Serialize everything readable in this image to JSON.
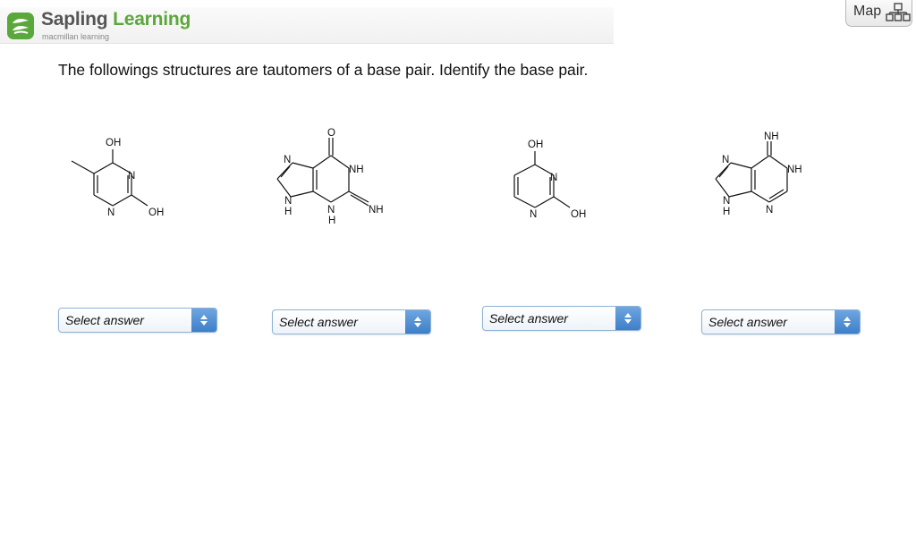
{
  "header": {
    "brand_part1": "Sapling",
    "brand_part2": "Learning",
    "brand_sub": "macmillan learning",
    "logo_icon": "sapling-leaf-icon"
  },
  "map_button": {
    "label": "Map",
    "icon": "sitemap-icon"
  },
  "question": {
    "text": "The followings structures are tautomers of a base pair. Identify the base pair."
  },
  "structures": {
    "s1": {
      "atoms": [
        "OH",
        "N",
        "N",
        "OH"
      ]
    },
    "s2": {
      "atoms": [
        "O",
        "N",
        "NH",
        "N",
        "H",
        "N",
        "H",
        "NH"
      ]
    },
    "s3": {
      "atoms": [
        "OH",
        "N",
        "N",
        "OH"
      ]
    },
    "s4": {
      "atoms": [
        "NH",
        "N",
        "NH",
        "N",
        "H",
        "N"
      ]
    }
  },
  "answers": [
    {
      "placeholder": "Select answer"
    },
    {
      "placeholder": "Select answer"
    },
    {
      "placeholder": "Select answer"
    },
    {
      "placeholder": "Select answer"
    }
  ],
  "colors": {
    "brand_green": "#5aa83b",
    "select_blue": "#3d7fc8"
  }
}
